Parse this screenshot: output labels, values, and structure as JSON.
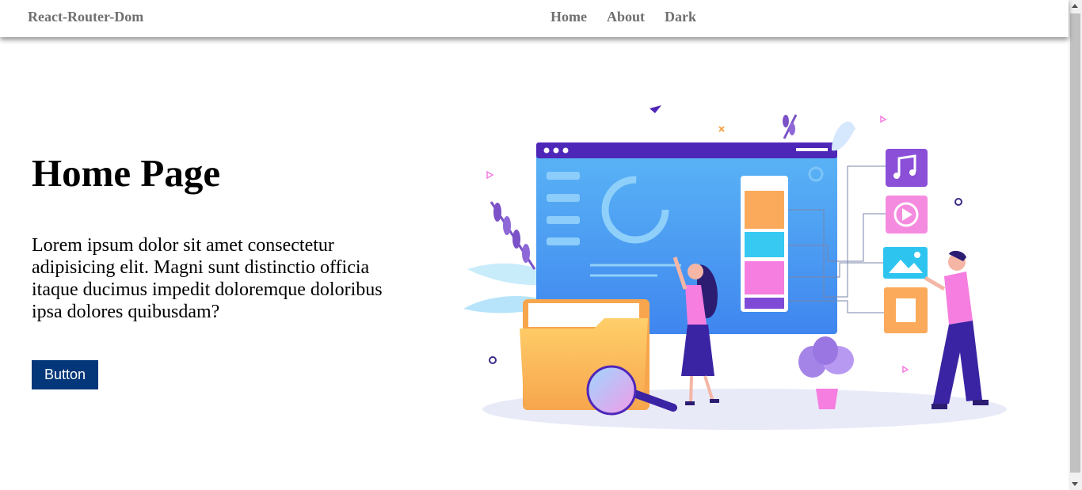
{
  "nav": {
    "brand": "React-Router-Dom",
    "links": [
      "Home",
      "About",
      "Dark"
    ]
  },
  "hero": {
    "title": "Home Page",
    "body": "Lorem ipsum dolor sit amet consectetur adipisicing elit. Magni sunt distinctio officia itaque ducimus impedit doloremque doloribus ipsa dolores quibusdam?",
    "button_label": "Button"
  },
  "illustration": {
    "icons": [
      "music-icon",
      "play-icon",
      "image-icon",
      "document-icon",
      "settings-icon",
      "magnifier-icon",
      "folder-icon"
    ]
  },
  "colors": {
    "button": "#033779",
    "nav_text": "#707070"
  }
}
